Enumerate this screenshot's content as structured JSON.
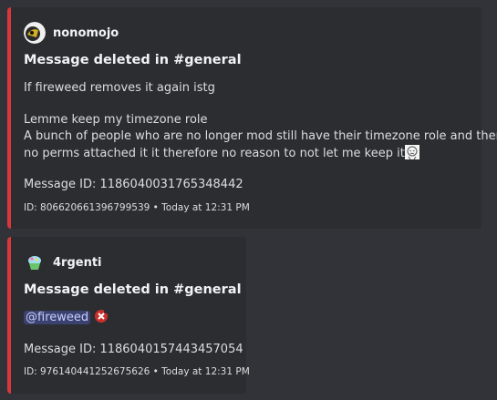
{
  "embeds": [
    {
      "author": "nonomojo",
      "title": "Message deleted in #general",
      "lines": [
        "If fireweed removes it again istg",
        "Lemme keep my timezone role",
        "A bunch of people who are no longer mod still have their timezone role and there's",
        "no perms attached it it therefore no reason to not let me keep it"
      ],
      "message_id_line": "Message ID: 1186040031765348442",
      "footer": "ID: 806620661396799539 • Today at 12:31 PM",
      "emoji": "crying-face-emoji"
    },
    {
      "author": "4rgenti",
      "title": "Message deleted in #general",
      "mention": "@fireweed",
      "emoji": "red-x-emoji",
      "message_id_line": "Message ID: 1186040157443457054",
      "footer": "ID: 976140441252675626 • Today at 12:31 PM"
    }
  ],
  "colors": {
    "accent_border": "#da373c",
    "mention_bg": "#3c4270",
    "mention_text": "#c9cdfb"
  }
}
